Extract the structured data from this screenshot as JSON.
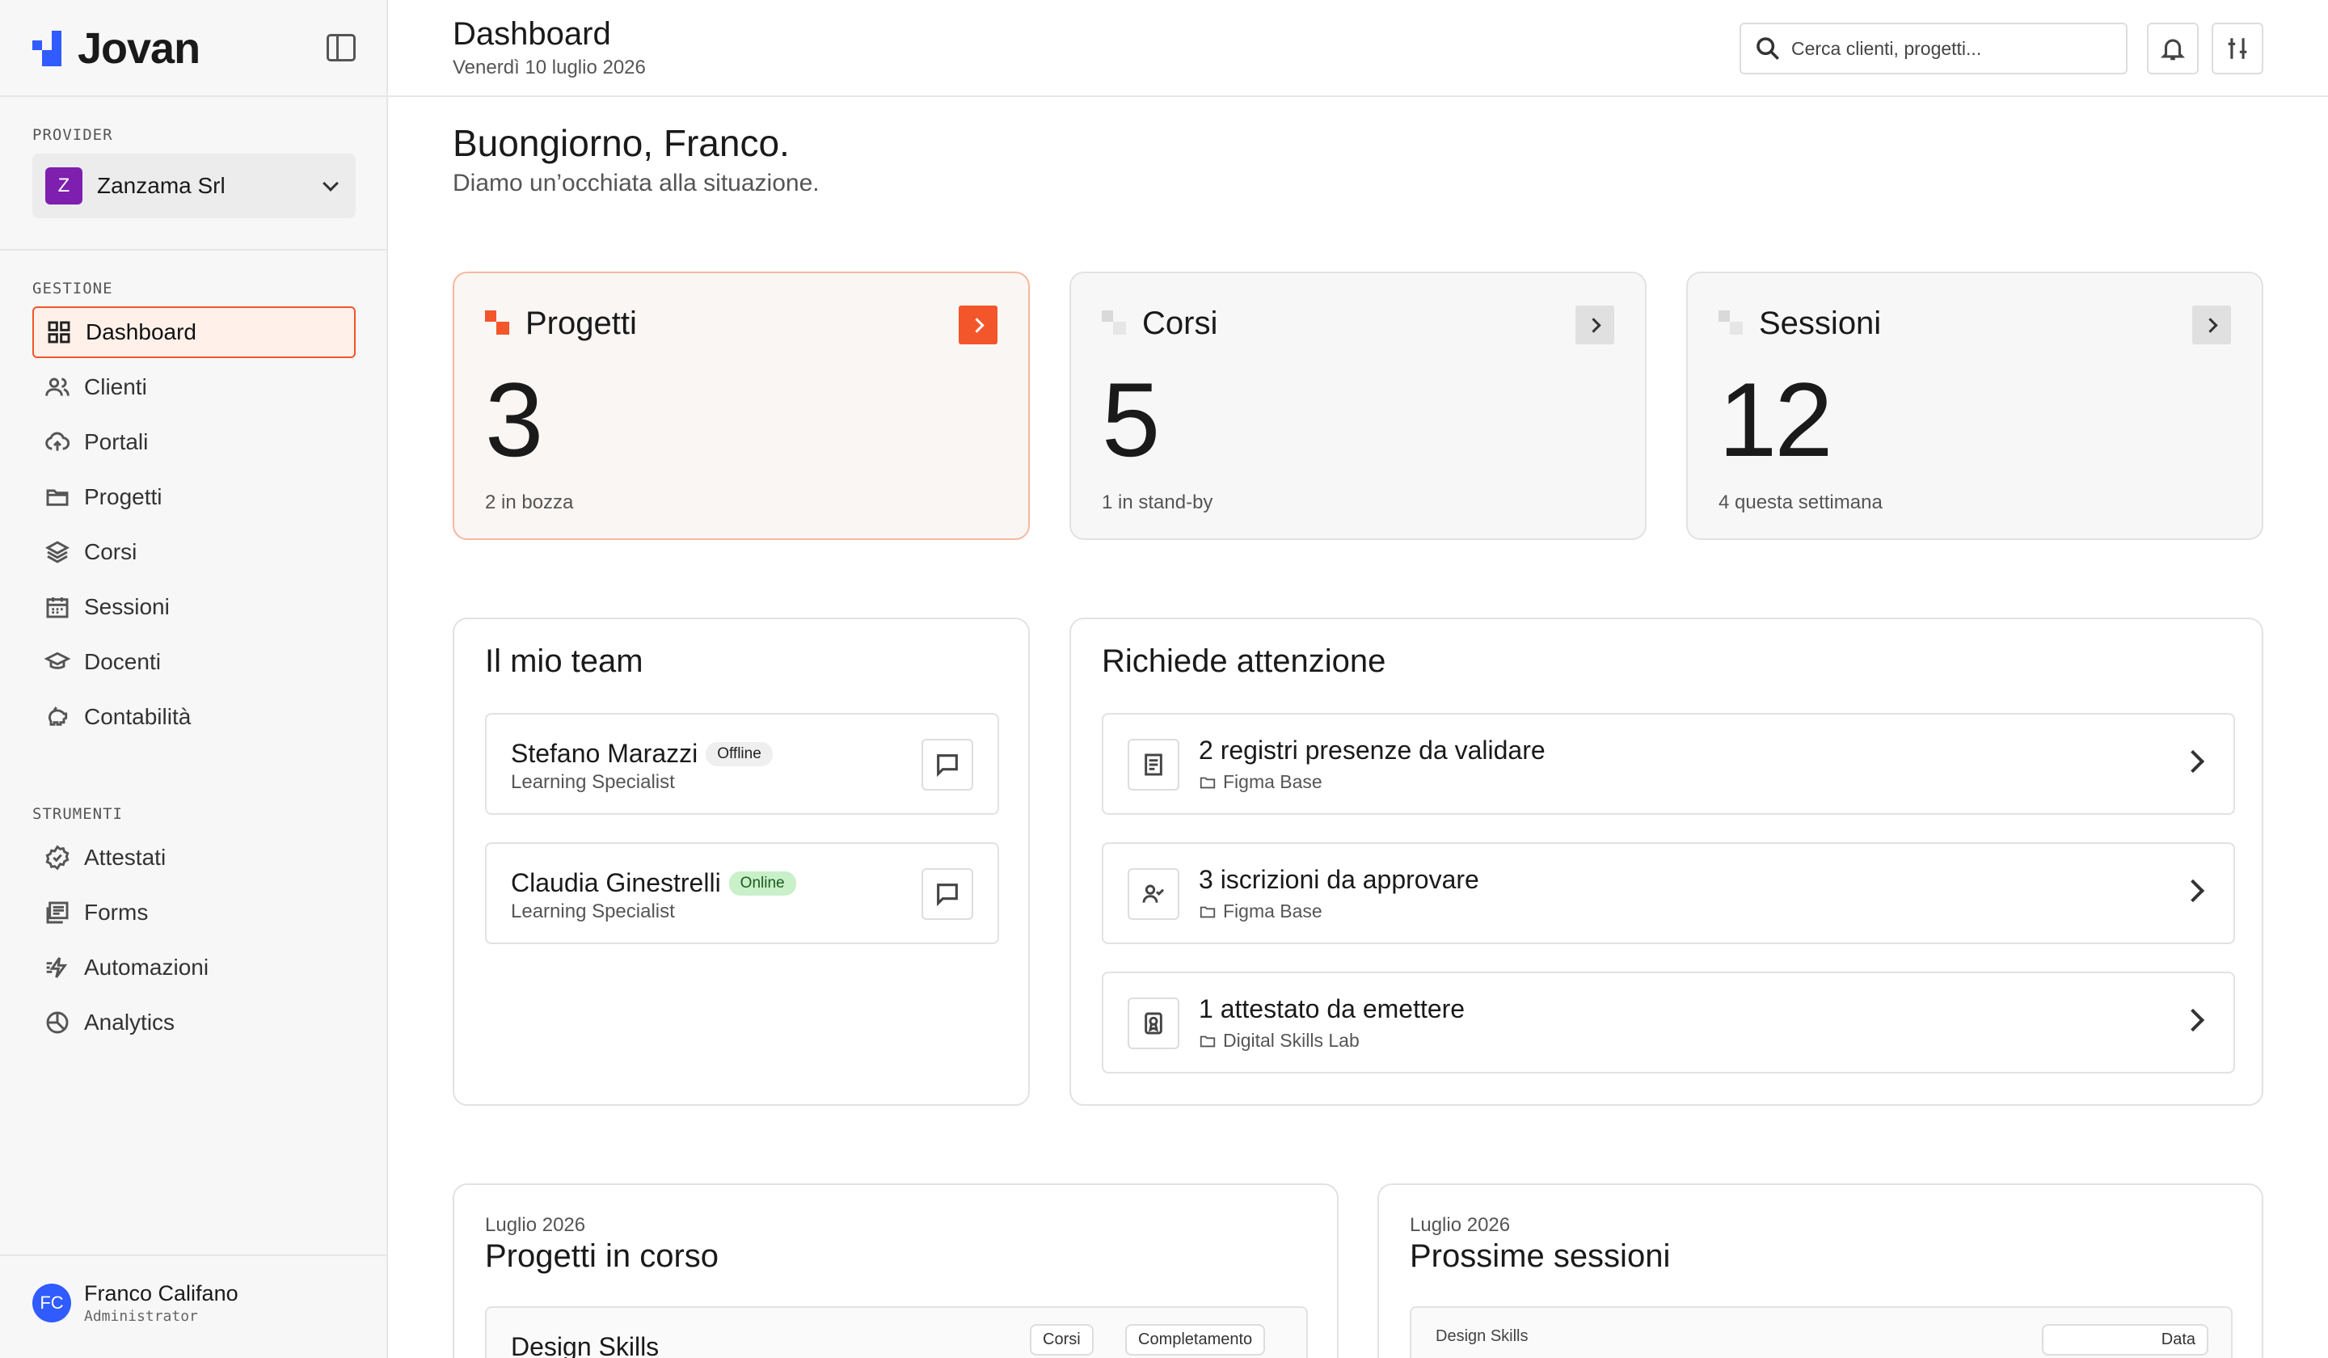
{
  "app": {
    "name": "Jovan"
  },
  "sidebar": {
    "provider_label": "PROVIDER",
    "provider": {
      "initial": "Z",
      "name": "Zanzama Srl"
    },
    "gestione_label": "GESTIONE",
    "gestione": [
      {
        "label": "Dashboard",
        "icon": "dashboard-icon",
        "active": true
      },
      {
        "label": "Clienti",
        "icon": "users-icon"
      },
      {
        "label": "Portali",
        "icon": "cloud-upload-icon"
      },
      {
        "label": "Progetti",
        "icon": "folder-icon"
      },
      {
        "label": "Corsi",
        "icon": "layers-icon"
      },
      {
        "label": "Sessioni",
        "icon": "calendar-icon"
      },
      {
        "label": "Docenti",
        "icon": "graduation-cap-icon"
      },
      {
        "label": "Contabilità",
        "icon": "piggy-bank-icon"
      }
    ],
    "strumenti_label": "STRUMENTI",
    "strumenti": [
      {
        "label": "Attestati",
        "icon": "badge-check-icon"
      },
      {
        "label": "Forms",
        "icon": "form-icon"
      },
      {
        "label": "Automazioni",
        "icon": "zap-icon"
      },
      {
        "label": "Analytics",
        "icon": "chart-pie-icon"
      }
    ],
    "user": {
      "initials": "FC",
      "name": "Franco Califano",
      "role": "Administrator"
    }
  },
  "header": {
    "title": "Dashboard",
    "date": "Venerdì 10 luglio 2026",
    "search_placeholder": "Cerca clienti, progetti..."
  },
  "greeting": {
    "title": "Buongiorno, Franco.",
    "subtitle": "Diamo un’occhiata alla situazione."
  },
  "stats": [
    {
      "title": "Progetti",
      "value": "3",
      "sub": "2 in bozza",
      "accent": "#f2562a",
      "highlight": true
    },
    {
      "title": "Corsi",
      "value": "5",
      "sub": "1 in stand-by",
      "accent": "#d9d9d9",
      "highlight": false
    },
    {
      "title": "Sessioni",
      "value": "12",
      "sub": "4 questa settimana",
      "accent": "#d9d9d9",
      "highlight": false
    }
  ],
  "team": {
    "title": "Il mio team",
    "members": [
      {
        "name": "Stefano Marazzi",
        "status": "Offline",
        "role": "Learning Specialist"
      },
      {
        "name": "Claudia Ginestrelli",
        "status": "Online",
        "role": "Learning Specialist"
      }
    ]
  },
  "attention": {
    "title": "Richiede attenzione",
    "items": [
      {
        "title": "2 registri presenze da validare",
        "project": "Figma Base",
        "icon": "register-icon"
      },
      {
        "title": "3 iscrizioni da approvare",
        "project": "Figma Base",
        "icon": "user-check-icon"
      },
      {
        "title": "1 attestato da emettere",
        "project": "Digital Skills Lab",
        "icon": "award-icon"
      }
    ]
  },
  "projects_in_progress": {
    "month": "Luglio 2026",
    "title": "Progetti in corso",
    "first_item": "Design Skills",
    "col_corsi": "Corsi",
    "col_completamento": "Completamento"
  },
  "next_sessions": {
    "month": "Luglio 2026",
    "title": "Prossime sessioni",
    "first_item": "Design Skills",
    "col_data": "Data"
  },
  "colors": {
    "accent": "#f2562a",
    "brand": "#2f5bff",
    "provider": "#7e1fb0"
  }
}
